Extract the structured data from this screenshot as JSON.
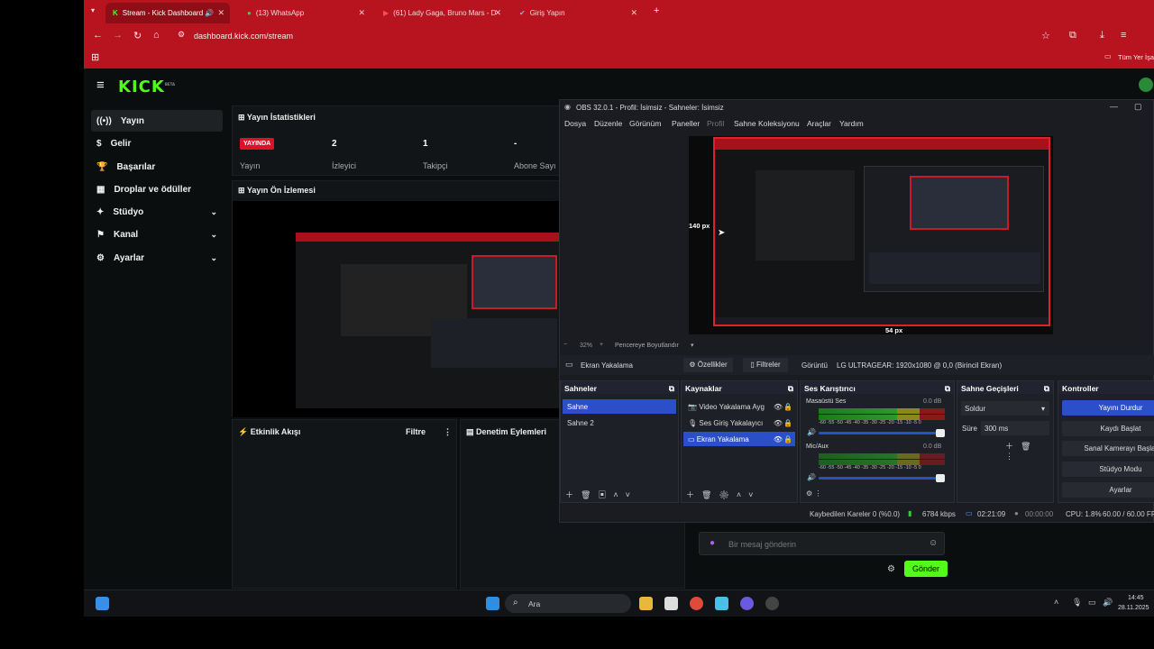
{
  "browser": {
    "tabs": [
      {
        "label": "Stream - Kick Dashboard",
        "active": true
      },
      {
        "label": "(13) WhatsApp"
      },
      {
        "label": "(61) Lady Gaga, Bruno Mars - D"
      },
      {
        "label": "Giriş Yapın"
      }
    ],
    "url": "dashboard.kick.com/stream",
    "bookmarks_label": "Tüm Yer İşa"
  },
  "kick": {
    "logo": "KICK",
    "logo_beta": "BETA",
    "sidebar": [
      {
        "label": "Yayın",
        "icon": "broadcast-icon",
        "selected": true
      },
      {
        "label": "Gelir",
        "icon": "dollar-icon"
      },
      {
        "label": "Başarılar",
        "icon": "trophy-icon"
      },
      {
        "label": "Droplar ve ödüller",
        "icon": "gift-icon"
      },
      {
        "label": "Stüdyo",
        "icon": "studio-icon",
        "expandable": true
      },
      {
        "label": "Kanal",
        "icon": "user-icon",
        "expandable": true
      },
      {
        "label": "Ayarlar",
        "icon": "gear-icon",
        "expandable": true
      }
    ],
    "stats": {
      "title": "Yayın İstatistikleri",
      "live_badge": "YAYINDA",
      "items": [
        {
          "value": "",
          "label": "Yayın"
        },
        {
          "value": "2",
          "label": "İzleyici"
        },
        {
          "value": "1",
          "label": "Takipçi"
        },
        {
          "value": "-",
          "label": "Abone Sayı"
        }
      ]
    },
    "preview_title": "Yayın Ön İzlemesi",
    "activity_title": "Etkinlik Akışı",
    "activity_filter": "Filtre",
    "moderation_title": "Denetim Eylemleri",
    "chat_placeholder": "Bir mesaj gönderin",
    "send_label": "Gönder"
  },
  "obs": {
    "title": "OBS 32.0.1 - Profil: İsimsiz - Sahneler: İsimsiz",
    "menu": [
      "Dosya",
      "Düzenle",
      "Görünüm",
      "Paneller",
      "Profil",
      "Sahne Koleksiyonu",
      "Araçlar",
      "Yardım"
    ],
    "preview_left_px": "140 px",
    "preview_bottom_px": "54 px",
    "zoom": "32%",
    "fit_label": "Pencereye Boyutlandır",
    "source_label": "Ekran Yakalama",
    "properties_label": "Özellikler",
    "filters_label": "Filtreler",
    "display_label": "Görüntü",
    "display_value": "LG ULTRAGEAR: 1920x1080 @ 0,0 (Birincil Ekran)",
    "scenes": {
      "title": "Sahneler",
      "items": [
        "Sahne",
        "Sahne 2"
      ]
    },
    "sources": {
      "title": "Kaynaklar",
      "items": [
        "Video Yakalama Ayg",
        "Ses Giriş Yakalayıcı",
        "Ekran Yakalama"
      ]
    },
    "mixer": {
      "title": "Ses Karıştırıcı",
      "channels": [
        {
          "name": "Masaüstü Ses",
          "db": "0.0 dB"
        },
        {
          "name": "Mic/Aux",
          "db": "0.0 dB"
        }
      ],
      "scale": "-60 -55 -50 -45 -40 -35 -30 -25 -20 -15 -10 -5 0"
    },
    "transitions": {
      "title": "Sahne Geçişleri",
      "type": "Soldur",
      "duration_label": "Süre",
      "duration": "300 ms"
    },
    "controls": {
      "title": "Kontroller",
      "buttons": [
        "Yayını Durdur",
        "Kaydı Başlat",
        "Sanal Kamerayı Başlat",
        "Stüdyo Modu",
        "Ayarlar"
      ]
    },
    "status": {
      "dropped": "Kaybedilen Kareler 0 (%0.0)",
      "bitrate": "6784 kbps",
      "stream_time": "02:21:09",
      "rec_time": "00:00:00",
      "cpu": "CPU: 1.8%",
      "fps": "60.00 / 60.00 FP"
    }
  },
  "taskbar": {
    "search": "Ara",
    "time": "14:45",
    "date": "28.11.2025"
  }
}
